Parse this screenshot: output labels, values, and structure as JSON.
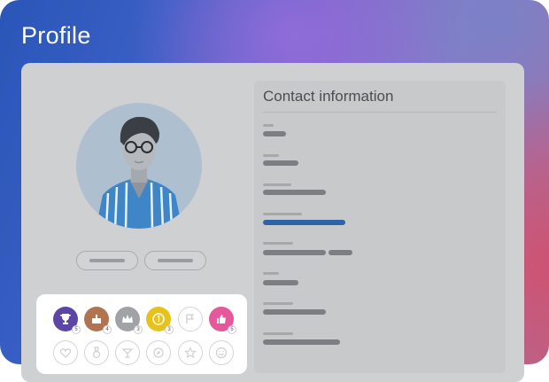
{
  "page": {
    "title": "Profile"
  },
  "contact": {
    "title": "Contact information"
  },
  "badges": {
    "earned": [
      {
        "icon": "trophy-icon",
        "color": "#5b46a8",
        "count": "5"
      },
      {
        "icon": "cake-icon",
        "color": "#b07450",
        "count": "4"
      },
      {
        "icon": "crown-icon",
        "color": "#a0a2a6",
        "count": "3"
      },
      {
        "icon": "coin-icon",
        "color": "#e6c21a",
        "count": "3"
      },
      {
        "icon": "flag-icon",
        "color": "#ffffff",
        "count": ""
      },
      {
        "icon": "thumbs-up-icon",
        "color": "#e7579b",
        "count": "5"
      }
    ],
    "locked": [
      {
        "icon": "heart-icon"
      },
      {
        "icon": "medal-icon"
      },
      {
        "icon": "cocktail-icon"
      },
      {
        "icon": "compass-icon"
      },
      {
        "icon": "star-icon"
      },
      {
        "icon": "smiley-icon"
      }
    ]
  },
  "colors": {
    "accent": "#2f63a7",
    "card": "#cfd0d2"
  }
}
